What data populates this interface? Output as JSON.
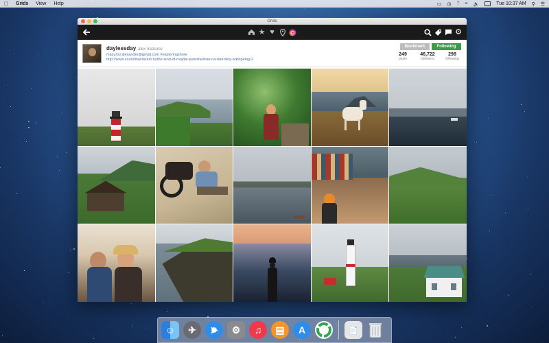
{
  "menubar": {
    "apple_icon": "apple-icon",
    "app_name": "Grids",
    "items": [
      "View",
      "Help"
    ],
    "clock": "Tue 10:37 AM"
  },
  "window": {
    "title": "Grids"
  },
  "toolbar": {
    "back_icon": "back-arrow-icon",
    "center_icons": [
      "home-icon",
      "star-icon",
      "heart-icon",
      "location-pin-icon",
      "instagram-icon"
    ],
    "right_icons": [
      "search-icon",
      "tag-icon",
      "message-icon",
      "gear-icon"
    ]
  },
  "profile": {
    "username": "daylessday",
    "real_name": "alex mazurov",
    "bio_line1": "mazurov.alexander@gmail.com #exploringshore",
    "bio_line2": "http://www.scandinaviaclub.ru/the-land-of-maybe-puteshestvie-na-farerskiy-arkhipelag-2",
    "bookmark_label": "Bookmark",
    "following_label": "Following",
    "stats": [
      {
        "value": "249",
        "label": "posts"
      },
      {
        "value": "46,722",
        "label": "followers"
      },
      {
        "value": "298",
        "label": "following"
      }
    ]
  },
  "colors": {
    "toolbar_bg": "#1a1a1a",
    "following_green": "#3d9b47",
    "bookmark_gray": "#bdbdbd",
    "link_blue": "#4a6fa5"
  },
  "dock": {
    "apps": [
      "finder-icon",
      "launchpad-icon",
      "safari-icon",
      "system-preferences-icon",
      "music-icon",
      "books-icon",
      "app-store-icon",
      "grids-icon",
      "documents-icon",
      "trash-icon"
    ]
  }
}
